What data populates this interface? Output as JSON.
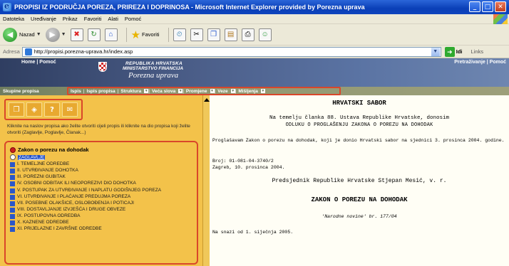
{
  "window": {
    "title": "PROPISI IZ PODRUČJA POREZA, PRIREZA I DOPRINOSA - Microsoft Internet Explorer provided by Porezna uprava"
  },
  "menu": [
    "Datoteka",
    "Uređivanje",
    "Prikaz",
    "Favoriti",
    "Alati",
    "Pomoć"
  ],
  "toolbar": {
    "back_label": "Nazad",
    "favorites_label": "Favoriti"
  },
  "address": {
    "label": "Adresa",
    "url": "http://propisi.porezna-uprava.hr/index.asp",
    "go_label": "Idi",
    "links_label": "Links"
  },
  "site_header": {
    "left_links": "Home | Pomoć",
    "right_links": "Pretraživanje | Pomoć",
    "line1": "REPUBLIKA HRVATSKA",
    "line2": "MINISTARSTVO FINANCIJA",
    "line3": "Porezna uprava"
  },
  "nav": {
    "prefix": "Skupine propisa",
    "items": [
      "Ispis",
      "Ispis propisa",
      "Struktura",
      "Veća slova",
      "Promjene",
      "Veze",
      "Mišljenja"
    ]
  },
  "left": {
    "help_text": "Kliknite na naslov propisa ako želite otvoriti cijeli propis ili kliknite na dio propisa koji želite otvoriti (Zaglavlje, Poglavlje, Članak...)",
    "doc_title": "Zakon o porezu na dohodak",
    "zaglavlje": "ZAGLAVLJE",
    "sections": [
      "I. TEMELJNE ODREDBE",
      "II. UTVRĐIVANJE DOHOTKA",
      "III. POREZNI GUBITAK",
      "IV. OSOBNI ODBITAK ILI NEOPOREZIVI DIO DOHOTKA",
      "V. POSTUPAK ZA UTVRĐIVANJE I NAPLATU GODIŠNJEG POREZA",
      "VI. UTVRĐIVANJE I PLAĆANJE PREDUJMA POREZA",
      "VII. POSEBNE OLAKŠICE, OSLOBOĐENJA I POTICAJI",
      "VIII. DOSTAVLJANJE IZVJEŠĆA I DRUGE OBVEZE",
      "IX. POSTUPOVNA ODREDBA",
      "X. KAZNENE ODREDBE",
      "XI. PRIJELAZNE I ZAVRŠNE ODREDBE"
    ]
  },
  "content": {
    "heading": "HRVATSKI SABOR",
    "intro_line1": "Na temelju članka 88. Ustava Republike Hrvatske, donosim",
    "intro_line2": "ODLUKU O PROGLAŠENJU ZAKONA O POREZU NA DOHODAK",
    "paragraph": "Proglašavam Zakon o porezu na dohodak, koji je donio Hrvatski sabor na sjednici 3. prosinca 2004. godine.",
    "broj": "Broj: 01-081-04-3740/2",
    "date": "Zagreb, 10. prosinca 2004.",
    "president": "Predsjednik Republike Hrvatske Stjepan Mesić, v. r.",
    "law_title": "ZAKON O POREZU NA DOHODAK",
    "gazette": "'Narodne novine' br. 177/04",
    "in_force": "Na snazi od 1. siječnja 2005."
  }
}
